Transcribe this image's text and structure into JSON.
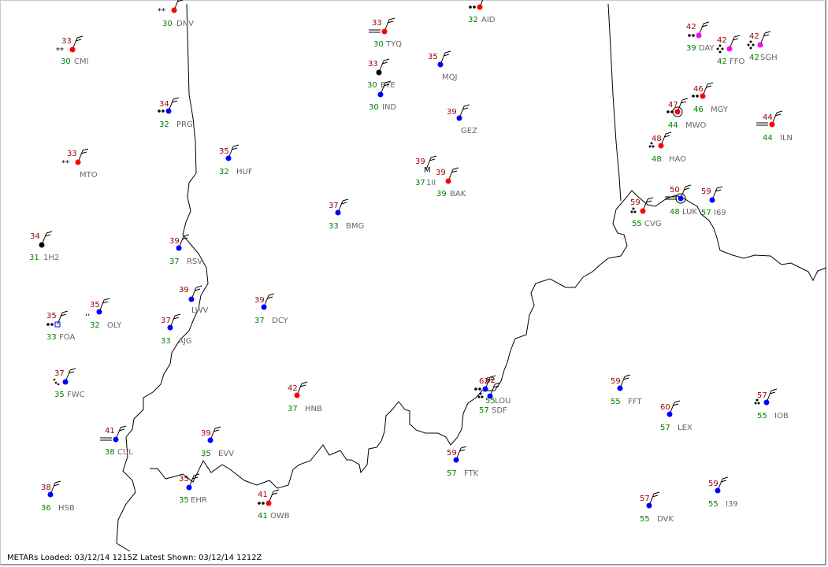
{
  "status_bar": {
    "text": "METARs Loaded: 03/12/14 1215Z Latest Shown: 03/12/14 1212Z"
  },
  "colors": {
    "boundary": "#000000",
    "temperature": "#990000",
    "dewpoint": "#008000",
    "station_id": "#666666",
    "marker_blue": "#0000ff",
    "marker_red": "#ff0000",
    "marker_magenta": "#ff00ff",
    "marker_black": "#000000"
  },
  "stations": [
    {
      "id": "DNV",
      "temp": "",
      "dew": "30",
      "marker": "red",
      "wx": "**"
    },
    {
      "id": "CMI",
      "temp": "33",
      "dew": "30",
      "marker": "red",
      "wx": "**"
    },
    {
      "id": "PRG",
      "temp": "34",
      "dew": "32",
      "marker": "blue",
      "wx": "••"
    },
    {
      "id": "MTO",
      "temp": "33",
      "dew": "",
      "marker": "red",
      "wx": "**"
    },
    {
      "id": "HUF",
      "temp": "35",
      "dew": "32",
      "marker": "blue",
      "wx": ""
    },
    {
      "id": "1H2",
      "temp": "34",
      "dew": "31",
      "marker": "black",
      "wx": ""
    },
    {
      "id": "RSV",
      "temp": "39",
      "dew": "37",
      "marker": "blue",
      "wx": ""
    },
    {
      "id": "LWV",
      "temp": "39",
      "dew": "",
      "marker": "blue",
      "wx": ""
    },
    {
      "id": "AJG",
      "temp": "37",
      "dew": "33",
      "marker": "blue",
      "wx": ""
    },
    {
      "id": "OLY",
      "temp": "35",
      "dew": "32",
      "marker": "blue",
      "wx": ","
    },
    {
      "id": "FOA",
      "temp": "35",
      "dew": "33",
      "marker": "square",
      "wx": "••"
    },
    {
      "id": "FWC",
      "temp": "37",
      "dew": "35",
      "marker": "blue",
      "wx": "drizzle"
    },
    {
      "id": "CUL",
      "temp": "41",
      "dew": "38",
      "marker": "blue",
      "wx": "fog"
    },
    {
      "id": "HSB",
      "temp": "38",
      "dew": "36",
      "marker": "blue",
      "wx": ""
    },
    {
      "id": "EVV",
      "temp": "39",
      "dew": "35",
      "marker": "blue",
      "wx": ""
    },
    {
      "id": "EHR",
      "temp": "35",
      "dew": "35",
      "marker": "blue",
      "wx": ""
    },
    {
      "id": "OWB",
      "temp": "41",
      "dew": "41",
      "marker": "red",
      "wx": "••"
    },
    {
      "id": "HNB",
      "temp": "42",
      "dew": "37",
      "marker": "red",
      "wx": ""
    },
    {
      "id": "DCY",
      "temp": "39",
      "dew": "37",
      "marker": "blue",
      "wx": ""
    },
    {
      "id": "BMG",
      "temp": "37",
      "dew": "33",
      "marker": "blue",
      "wx": ""
    },
    {
      "id": "TYQ",
      "temp": "33",
      "dew": "30",
      "marker": "red",
      "wx": "fog"
    },
    {
      "id": "EYE",
      "temp": "33",
      "dew": "30",
      "marker": "black",
      "wx": ""
    },
    {
      "id": "IND",
      "temp": "",
      "dew": "30",
      "marker": "blue",
      "wx": ""
    },
    {
      "id": "MQJ",
      "temp": "35",
      "dew": "",
      "marker": "blue",
      "wx": ""
    },
    {
      "id": "AID",
      "temp": "",
      "dew": "32",
      "marker": "red",
      "wx": "••"
    },
    {
      "id": "GEZ",
      "temp": "39",
      "dew": "",
      "marker": "blue",
      "wx": ""
    },
    {
      "id": "1II",
      "temp": "39",
      "dew": "37",
      "marker": "M",
      "wx": ""
    },
    {
      "id": "BAK",
      "temp": "39",
      "dew": "39",
      "marker": "red",
      "wx": ""
    },
    {
      "id": "DAY",
      "temp": "42",
      "dew": "39",
      "marker": "magenta",
      "wx": "••"
    },
    {
      "id": "FFO",
      "temp": "42",
      "dew": "42",
      "marker": "magenta",
      "wx": "diamond"
    },
    {
      "id": "SGH",
      "temp": "42",
      "dew": "42",
      "marker": "magenta",
      "wx": "diamond"
    },
    {
      "id": "MGY",
      "temp": "46",
      "dew": "46",
      "marker": "red",
      "wx": "••"
    },
    {
      "id": "MWO",
      "temp": "47",
      "dew": "44",
      "marker": "redring",
      "wx": "••"
    },
    {
      "id": "ILN",
      "temp": "44",
      "dew": "44",
      "marker": "red",
      "wx": "fog"
    },
    {
      "id": "HAO",
      "temp": "48",
      "dew": "48",
      "marker": "red",
      "wx": "tri"
    },
    {
      "id": "LUK",
      "temp": "50",
      "dew": "48",
      "marker": "bluering",
      "wx": "fog"
    },
    {
      "id": "I69",
      "temp": "59",
      "dew": "57",
      "marker": "blue",
      "wx": ""
    },
    {
      "id": "CVG",
      "temp": "59",
      "dew": "55",
      "marker": "red",
      "wx": "tri"
    },
    {
      "id": "LOU",
      "temp": "62",
      "dew": "55",
      "marker": "blue",
      "wx": "tri"
    },
    {
      "id": "SDF",
      "temp": "62",
      "dew": "57",
      "marker": "blue",
      "wx": "••"
    },
    {
      "id": "FTK",
      "temp": "59",
      "dew": "57",
      "marker": "blue",
      "wx": ""
    },
    {
      "id": "FFT",
      "temp": "59",
      "dew": "55",
      "marker": "blue",
      "wx": ""
    },
    {
      "id": "LEX",
      "temp": "60",
      "dew": "57",
      "marker": "blue",
      "wx": ""
    },
    {
      "id": "IOB",
      "temp": "57",
      "dew": "55",
      "marker": "blue",
      "wx": "tri"
    },
    {
      "id": "DVK",
      "temp": "57",
      "dew": "55",
      "marker": "blue",
      "wx": ""
    },
    {
      "id": "I39",
      "temp": "59",
      "dew": "55",
      "marker": "blue",
      "wx": ""
    }
  ]
}
